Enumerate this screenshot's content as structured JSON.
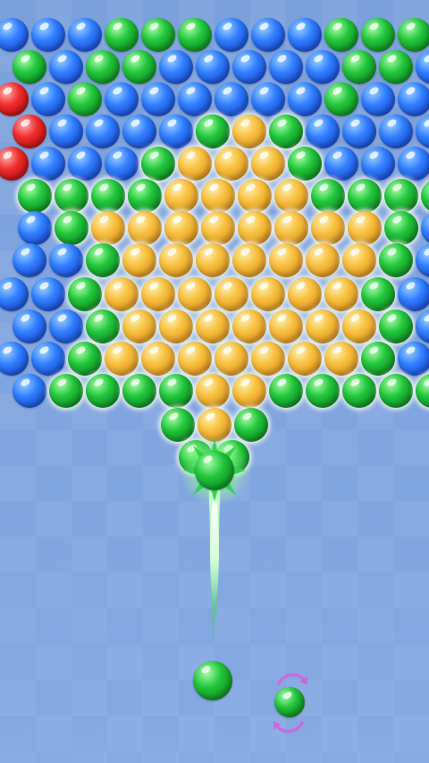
{
  "game": {
    "shooter_color": "green",
    "next_color": "green",
    "colors": {
      "blue": "#2f7dff",
      "green": "#20c43a",
      "red": "#f02a2a",
      "orange": "#f7bd3a",
      "swap_arrows": "#c96be0"
    },
    "icons": {
      "swap": "swap-arrows-icon"
    }
  }
}
